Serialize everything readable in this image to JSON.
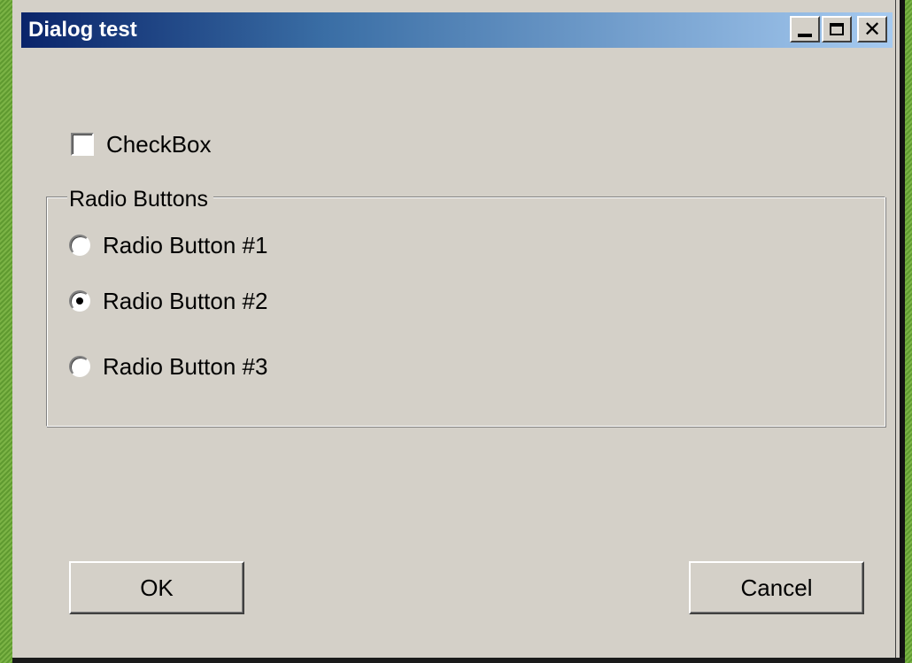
{
  "window": {
    "title": "Dialog test",
    "close_glyph": "✕"
  },
  "checkbox": {
    "label": "CheckBox",
    "checked": false
  },
  "radio_group": {
    "legend": "Radio Buttons",
    "options": [
      {
        "label": "Radio Button #1",
        "selected": false
      },
      {
        "label": "Radio Button #2",
        "selected": true
      },
      {
        "label": "Radio Button #3",
        "selected": false
      }
    ]
  },
  "buttons": {
    "ok_label": "OK",
    "cancel_label": "Cancel"
  },
  "colors": {
    "dialog_background": "#d4d0c8",
    "titlebar_start": "#0a246a",
    "titlebar_end": "#a6caf0",
    "desktop": "#6da53c"
  }
}
